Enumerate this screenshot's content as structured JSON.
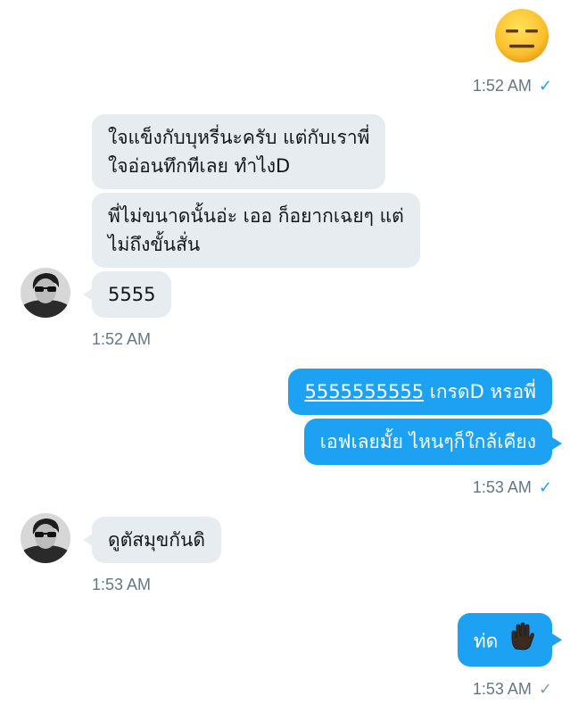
{
  "messages": {
    "m1": {
      "text": "😑",
      "time": "1:52 AM"
    },
    "m2": {
      "line1": "ใจแข็งกับบุหรี่นะครับ แต่กับเราพี่",
      "line2": "ใจอ่อนทึกทีเลย ทำไงD"
    },
    "m3": {
      "line1": "พี่ไม่ขนาดนั้นอ่ะ เออ ก็อยากเฉยๆ แต่",
      "line2": "ไม่ถึงขั้นสั่น"
    },
    "m4": {
      "text": "5555",
      "time": "1:52 AM"
    },
    "m5": {
      "link": "5555555555",
      "rest": " เกรดD หรอพี่"
    },
    "m6": {
      "text": "เอฟเลยมั้ย ไหนๆก็ใกล้เคียง",
      "time": "1:53 AM"
    },
    "m7": {
      "text": "ดูตัสมุขกันดิ",
      "time": "1:53 AM"
    },
    "m8": {
      "text": "ท่ด",
      "emoji": "✋🏿",
      "time": "1:53 AM"
    }
  },
  "icons": {
    "read_check": "✓",
    "unread_check": "✓"
  },
  "colors": {
    "outgoing_bubble": "#1da1f2",
    "incoming_bubble": "#e6ecf0",
    "timestamp": "#657786",
    "read_check": "#1da1f2"
  }
}
